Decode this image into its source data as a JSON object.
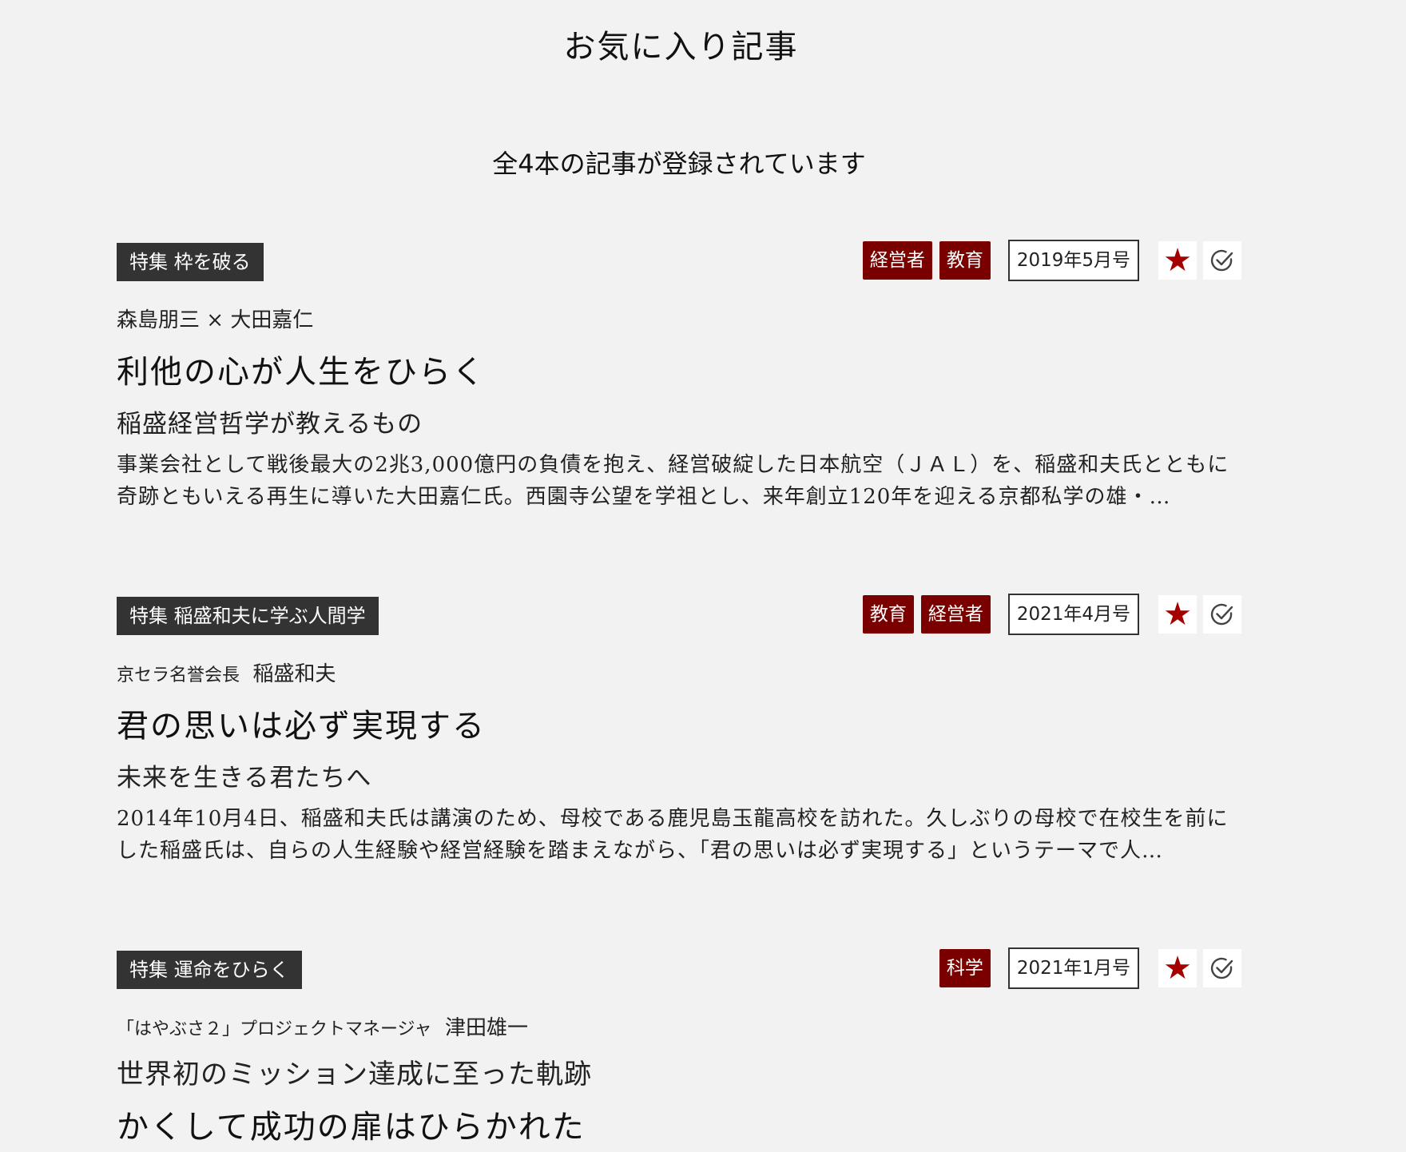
{
  "page": {
    "title": "お気に入り記事",
    "count_text": "全4本の記事が登録されています"
  },
  "articles": [
    {
      "feature": "特集 枠を破る",
      "tags": [
        "経営者",
        "教育"
      ],
      "issue": "2019年5月号",
      "author_org": "",
      "author": "森島朋三 × 大田嘉仁",
      "headline": "利他の心が人生をひらく",
      "subhead": "稲盛経営哲学が教えるもの",
      "excerpt": "事業会社として戦後最大の2兆3,000億円の負債を抱え、経営破綻した日本航空（ＪＡＬ）を、稲盛和夫氏とともに奇跡ともいえる再生に導いた大田嘉仁氏。西園寺公望を学祖とし、来年創立120年を迎える京都私学の雄・…",
      "favorite_icon": "star-icon",
      "read_icon": "check-circle-icon"
    },
    {
      "feature": "特集 稲盛和夫に学ぶ人間学",
      "tags": [
        "教育",
        "経営者"
      ],
      "issue": "2021年4月号",
      "author_org": "京セラ名誉会長",
      "author": "稲盛和夫",
      "headline": "君の思いは必ず実現する",
      "subhead": "未来を生きる君たちへ",
      "excerpt": "2014年10月4日、稲盛和夫氏は講演のため、母校である鹿児島玉龍高校を訪れた。久しぶりの母校で在校生を前にした稲盛氏は、自らの人生経験や経営経験を踏まえながら、「君の思いは必ず実現する」というテーマで人…",
      "favorite_icon": "star-icon",
      "read_icon": "check-circle-icon"
    },
    {
      "feature": "特集 運命をひらく",
      "tags": [
        "科学"
      ],
      "issue": "2021年1月号",
      "author_org": "「はやぶさ２」プロジェクトマネージャ",
      "author": "津田雄一",
      "headline": "世界初のミッション達成に至った軌跡",
      "subhead": "かくして成功の扉はひらかれた",
      "favorite_icon": "star-icon",
      "read_icon": "check-circle-icon"
    }
  ],
  "colors": {
    "background": "#f2f2f2",
    "tag": "#7a0000",
    "feature_label": "#333333",
    "star": "#a40000"
  }
}
